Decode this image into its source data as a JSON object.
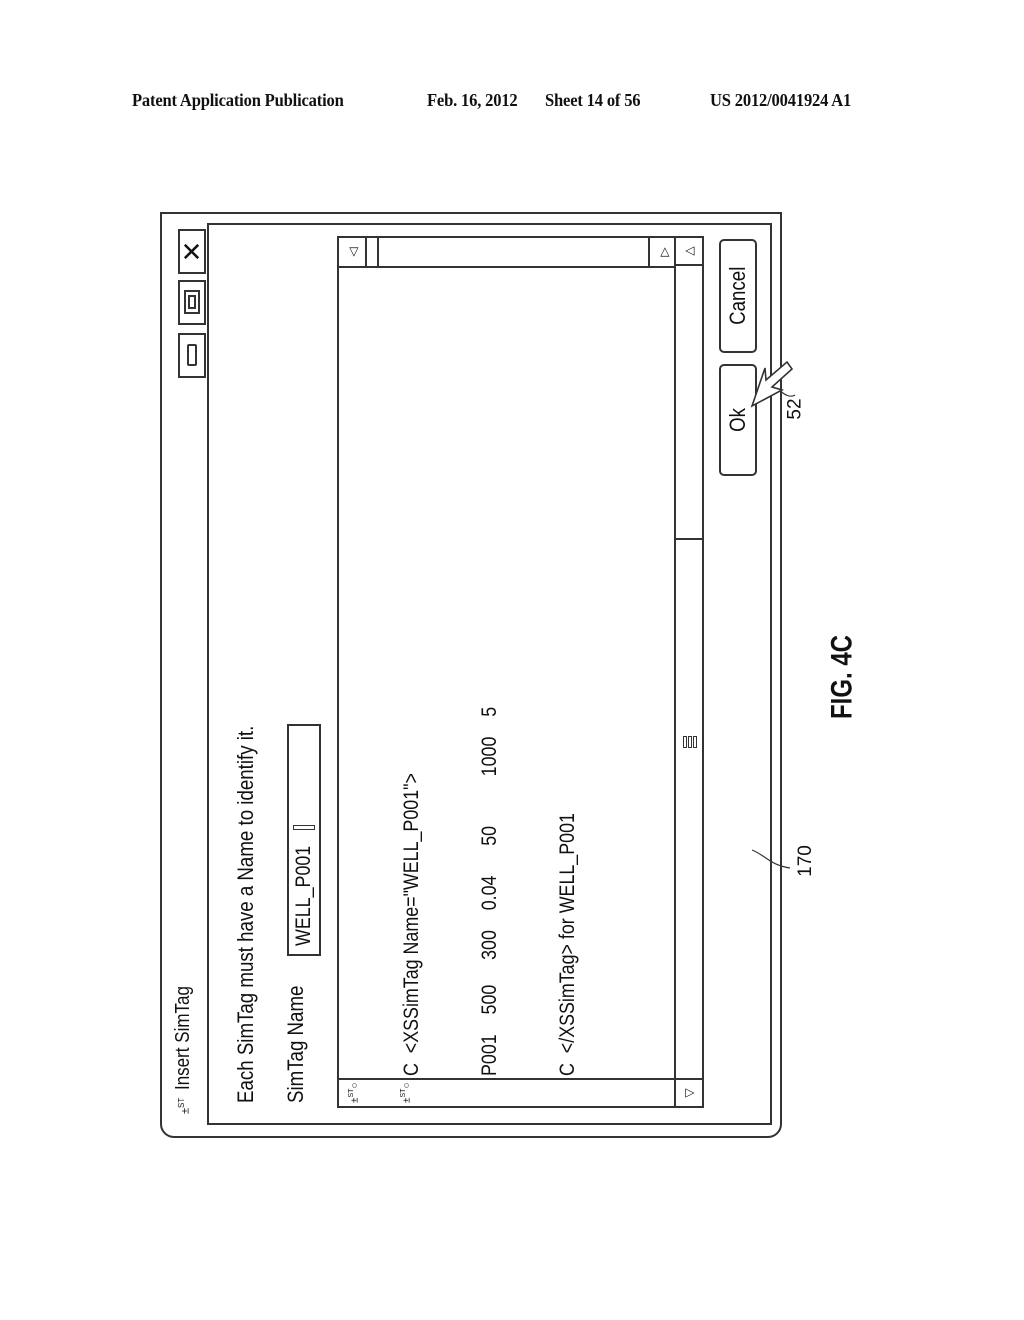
{
  "header": {
    "publication": "Patent Application Publication",
    "date": "Feb. 16, 2012",
    "sheet": "Sheet 14 of 56",
    "number": "US 2012/0041924 A1"
  },
  "dialog": {
    "title": "Insert SimTag",
    "title_icon": "simtag-icon",
    "window_buttons": [
      "minimize",
      "maximize",
      "close"
    ],
    "instruction": "Each SimTag must have a Name to identify it.",
    "name_label": "SimTag Name",
    "name_value": "WELL_P001",
    "code_lines": [
      "C  <XSSimTag Name=\"WELL_P001\">",
      "P001    500     300    0.04      50          1000    5",
      "C  </XSSimTag> for WELL_P001"
    ],
    "ok_label": "Ok",
    "cancel_label": "Cancel"
  },
  "callouts": {
    "window_ref": "170",
    "pointer_ref": "52"
  },
  "figure_label": "FIG. 4C"
}
